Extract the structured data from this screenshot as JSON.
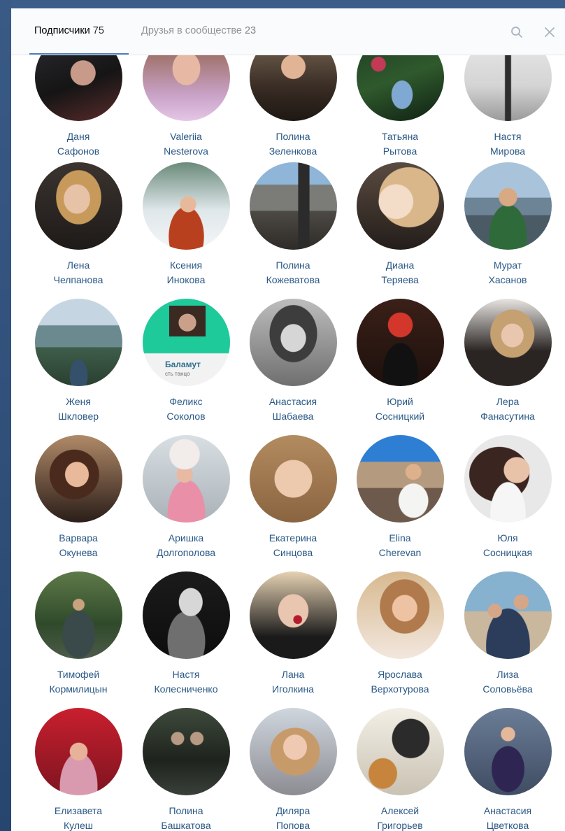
{
  "tabs": [
    {
      "label": "Подписчики",
      "count": "75"
    },
    {
      "label": "Друзья в сообществе",
      "count": "23"
    }
  ],
  "header_icons": [
    "search-icon",
    "close-icon"
  ],
  "colors": {
    "link": "#2a5885",
    "active_tab_underline": "#5181b8",
    "page_bg": "#2f4f7a"
  },
  "avatar_overlay_texts": {
    "baloo_card_title": "Баламут",
    "baloo_card_sub": "сть танцо"
  },
  "people": [
    {
      "first": "Даня",
      "last": "Сафонов"
    },
    {
      "first": "Valeriia",
      "last": "Nesterova"
    },
    {
      "first": "Полина",
      "last": "Зеленкова"
    },
    {
      "first": "Татьяна",
      "last": "Рытова"
    },
    {
      "first": "Настя",
      "last": "Мирова"
    },
    {
      "first": "Лена",
      "last": "Челпанова"
    },
    {
      "first": "Ксения",
      "last": "Инокова"
    },
    {
      "first": "Полина",
      "last": "Кожеватова"
    },
    {
      "first": "Диана",
      "last": "Теряева"
    },
    {
      "first": "Мурат",
      "last": "Хасанов"
    },
    {
      "first": "Женя",
      "last": "Шкловер"
    },
    {
      "first": "Феликс",
      "last": "Соколов"
    },
    {
      "first": "Анастасия",
      "last": "Шабаева"
    },
    {
      "first": "Юрий",
      "last": "Сосницкий"
    },
    {
      "first": "Лера",
      "last": "Фанасутина"
    },
    {
      "first": "Варвара",
      "last": "Окунева"
    },
    {
      "first": "Аришка",
      "last": "Долгополова"
    },
    {
      "first": "Екатерина",
      "last": "Синцова"
    },
    {
      "first": "Elina",
      "last": "Cherevan"
    },
    {
      "first": "Юля",
      "last": "Сосницкая"
    },
    {
      "first": "Тимофей",
      "last": "Кормилицын"
    },
    {
      "first": "Настя",
      "last": "Колесниченко"
    },
    {
      "first": "Лана",
      "last": "Иголкина"
    },
    {
      "first": "Ярослава",
      "last": "Верхотурова"
    },
    {
      "first": "Лиза",
      "last": "Соловьёва"
    },
    {
      "first": "Елизавета",
      "last": "Кулеш"
    },
    {
      "first": "Полина",
      "last": "Башкатова"
    },
    {
      "first": "Диляра",
      "last": "Попова"
    },
    {
      "first": "Алексей",
      "last": "Григорьев"
    },
    {
      "first": "Анастасия",
      "last": "Цветкова"
    }
  ]
}
